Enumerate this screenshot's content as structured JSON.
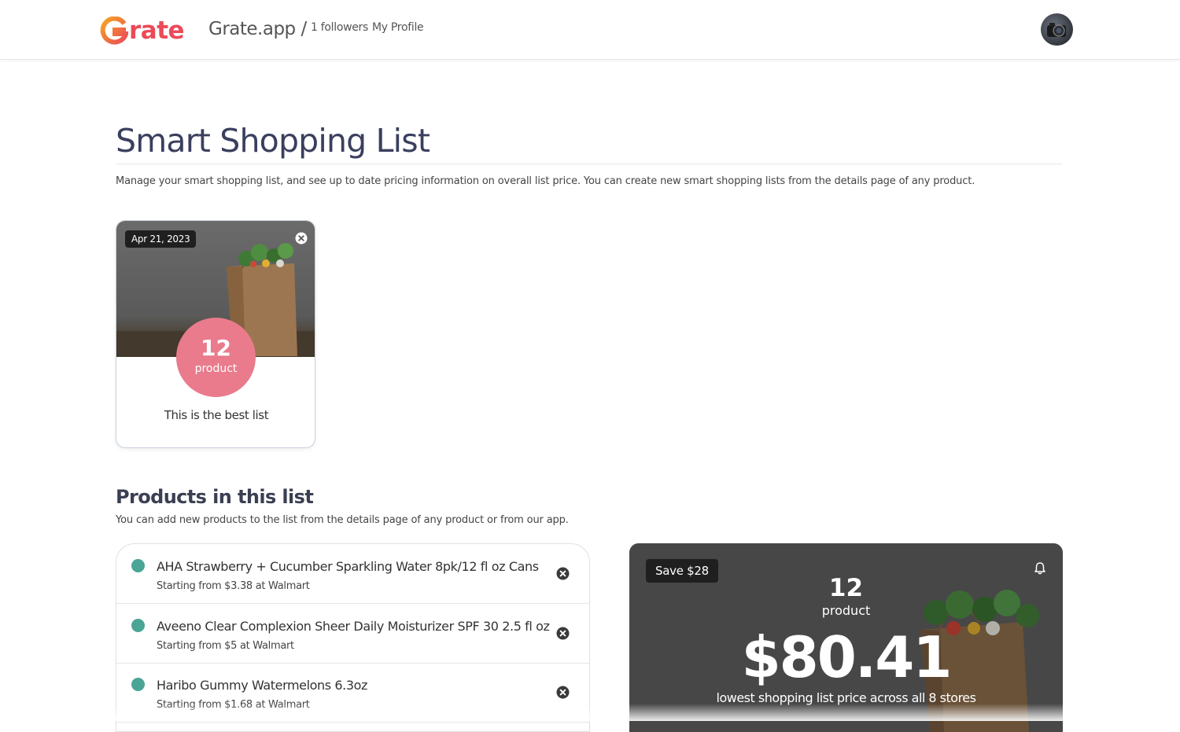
{
  "header": {
    "logo_text": "rate",
    "logo_letter": "G",
    "brand": "Grate.app /",
    "followers": "1 followers",
    "profile_link": "My Profile"
  },
  "page": {
    "title": "Smart Shopping List",
    "description": "Manage your smart shopping list, and see up to date pricing information on overall list price. You can create new smart shopping lists from the details page of any product."
  },
  "list_card": {
    "date": "Apr 21, 2023",
    "count": "12",
    "count_label": "product",
    "name": "This is the best list"
  },
  "products_section": {
    "title": "Products in this list",
    "description": "You can add new products to the list from the details page of any product or from our app.",
    "items": [
      {
        "name": "AHA Strawberry + Cucumber Sparkling Water 8pk/12 fl oz Cans",
        "price": "Starting from $3.38 at Walmart"
      },
      {
        "name": "Aveeno Clear Complexion Sheer Daily Moisturizer SPF 30 2.5 fl oz",
        "price": "Starting from $5 at Walmart"
      },
      {
        "name": "Haribo Gummy Watermelons 6.3oz",
        "price": "Starting from $1.68 at Walmart"
      }
    ]
  },
  "summary": {
    "save_badge": "Save $28",
    "count": "12",
    "count_label": "product",
    "price": "$80.41",
    "note": "lowest shopping list price across all 8 stores"
  },
  "colors": {
    "brand_red": "#ec4a58",
    "count_circle": "#e97b8c",
    "dot_teal": "#4aa596",
    "title_navy": "#3a3f5e"
  },
  "icons": {
    "card_close": "close-circle-icon",
    "product_remove": "close-circle-icon",
    "summary_bell": "bell-icon",
    "logo": "grate-logo-icon"
  }
}
